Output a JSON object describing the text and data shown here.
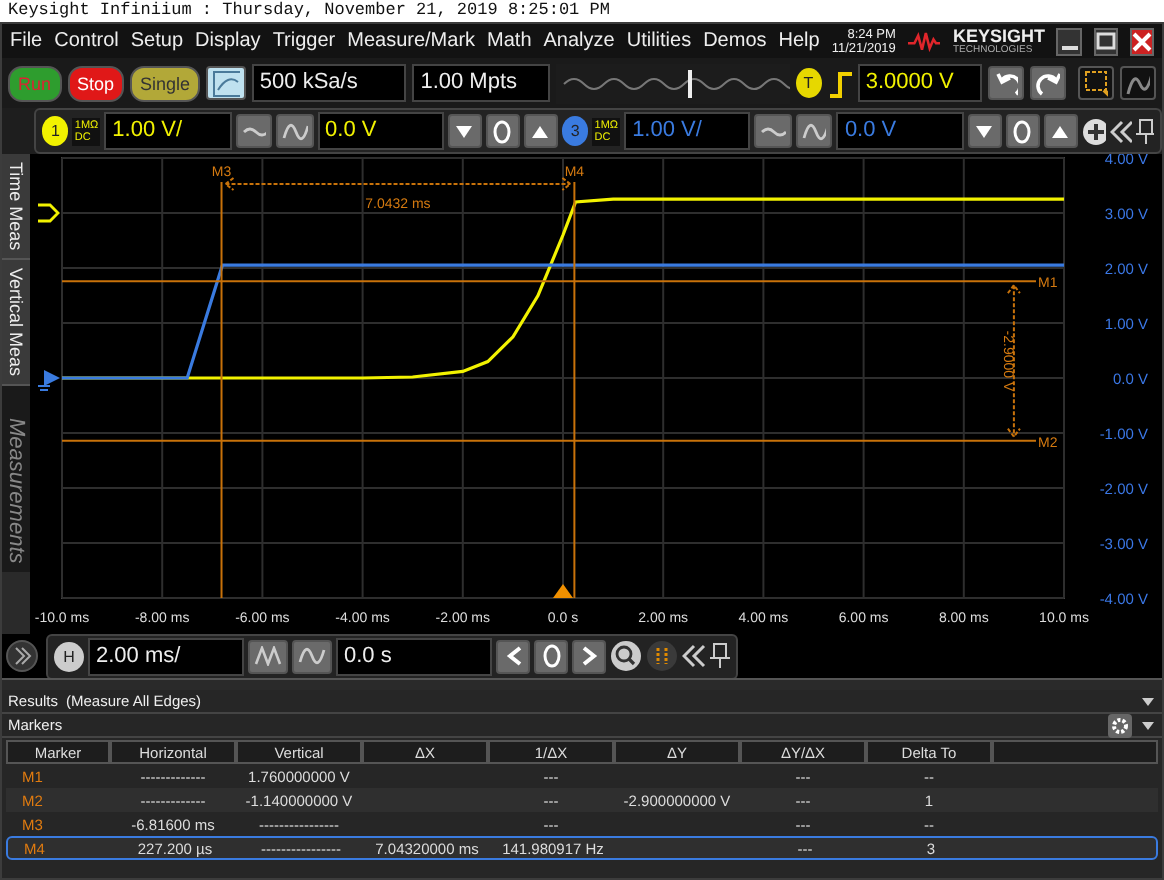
{
  "title_bar": {
    "text": "Keysight Infiniium : Thursday, November 21, 2019 8:25:01 PM"
  },
  "menu": [
    "File",
    "Control",
    "Setup",
    "Display",
    "Trigger",
    "Measure/Mark",
    "Math",
    "Analyze",
    "Utilities",
    "Demos",
    "Help"
  ],
  "clock": {
    "time": "8:24 PM",
    "date": "11/21/2019"
  },
  "brand": {
    "name": "KEYSIGHT",
    "sub": "TECHNOLOGIES"
  },
  "run_buttons": [
    {
      "label": "Run",
      "kind": "run"
    },
    {
      "label": "Stop",
      "kind": "stop"
    },
    {
      "label": "Single",
      "kind": "single"
    }
  ],
  "acquisition": {
    "sample_rate": "500 kSa/s",
    "memory": "1.00 Mpts"
  },
  "trigger": {
    "badge": "T",
    "level": "3.0000 V"
  },
  "channels": [
    {
      "impedance": "1MΩ",
      "coupling": "DC",
      "scale": "1.00 V/",
      "offset": "0.0 V"
    },
    {
      "impedance": "1MΩ",
      "coupling": "DC",
      "scale": "1.00 V/",
      "offset": "0.0 V"
    }
  ],
  "side_tabs": [
    {
      "label": "Time Meas",
      "disabled": false
    },
    {
      "label": "Vertical Meas",
      "disabled": false
    },
    {
      "label": "Measurements",
      "disabled": true
    }
  ],
  "scope": {
    "chart_data": {
      "type": "line",
      "x": [
        -10,
        -8,
        -7.5,
        -6.8,
        -6,
        -4,
        -3,
        -2,
        -1.5,
        -1,
        -0.5,
        0,
        0.25,
        1,
        2,
        4,
        6,
        8,
        10
      ],
      "series": [
        {
          "name": "1",
          "color": "#f2f200",
          "values": [
            0,
            0,
            0,
            0,
            0,
            0,
            0.02,
            0.12,
            0.3,
            0.75,
            1.5,
            2.6,
            3.2,
            3.25,
            3.25,
            3.25,
            3.25,
            3.25,
            3.25
          ]
        },
        {
          "name": "3",
          "color": "#3a7be0",
          "values": [
            0,
            0,
            0,
            2.05,
            2.05,
            2.05,
            2.05,
            2.05,
            2.05,
            2.05,
            2.05,
            2.05,
            2.05,
            2.05,
            2.05,
            2.05,
            2.05,
            2.05,
            2.05
          ]
        }
      ],
      "xlim": [
        -10,
        10
      ],
      "ylim": [
        -4,
        4
      ],
      "xticks": [
        {
          "value": -10,
          "label": "-10.0 ms"
        },
        {
          "value": -8,
          "label": "-8.00 ms"
        },
        {
          "value": -6,
          "label": "-6.00 ms"
        },
        {
          "value": -4,
          "label": "-4.00 ms"
        },
        {
          "value": -2,
          "label": "-2.00 ms"
        },
        {
          "value": 0,
          "label": "0.0 s"
        },
        {
          "value": 2,
          "label": "2.00 ms"
        },
        {
          "value": 4,
          "label": "4.00 ms"
        },
        {
          "value": 6,
          "label": "6.00 ms"
        },
        {
          "value": 8,
          "label": "8.00 ms"
        },
        {
          "value": 10,
          "label": "10.0 ms"
        }
      ],
      "yticks": [
        {
          "value": 4,
          "label": "4.00 V"
        },
        {
          "value": 3,
          "label": "3.00 V"
        },
        {
          "value": 2,
          "label": "2.00 V"
        },
        {
          "value": 1,
          "label": "1.00 V"
        },
        {
          "value": 0,
          "label": "0.0 V"
        },
        {
          "value": -1,
          "label": "-1.00 V"
        },
        {
          "value": -2,
          "label": "-2.00 V"
        },
        {
          "value": -3,
          "label": "-3.00 V"
        },
        {
          "value": -4,
          "label": "-4.00 V"
        }
      ],
      "ref_lines": [
        {
          "axis": "y",
          "value": 1.76,
          "label": "M1"
        },
        {
          "axis": "y",
          "value": -1.14,
          "label": "M2"
        },
        {
          "axis": "x",
          "value": -6.816,
          "label": "M3"
        },
        {
          "axis": "x",
          "value": 0.2272,
          "label": "M4"
        }
      ],
      "grid": true,
      "annotations": [
        "7.0432 ms",
        "-2.9000 V"
      ]
    }
  },
  "timebase": {
    "badge": "H",
    "scale": "2.00 ms/",
    "position": "0.0 s"
  },
  "results": {
    "title": "Results",
    "subtitle": "(Measure All Edges)"
  },
  "markers_panel": {
    "title": "Markers",
    "columns": [
      "Marker",
      "Horizontal",
      "Vertical",
      "ΔX",
      "1/ΔX",
      "ΔY",
      "ΔY/ΔX",
      "Delta To"
    ],
    "rows": [
      {
        "marker": "M1",
        "horizontal": "-------------",
        "vertical": "1.760000000 V",
        "inv_dx": "---",
        "dy_dx": "---",
        "delta_to": "--",
        "selected": false
      },
      {
        "marker": "M2",
        "horizontal": "-------------",
        "vertical": "-1.140000000 V",
        "inv_dx": "---",
        "dy": "-2.900000000 V",
        "dy_dx": "---",
        "delta_to": "1",
        "selected": false
      },
      {
        "marker": "M3",
        "horizontal": "-6.81600 ms",
        "vertical": "----------------",
        "inv_dx": "---",
        "dy_dx": "---",
        "delta_to": "--",
        "selected": false
      },
      {
        "marker": "M4",
        "horizontal": "227.200 µs",
        "vertical": "----------------",
        "dx": "7.04320000 ms",
        "inv_dx": "141.980917 Hz",
        "dy_dx": "---",
        "delta_to": "3",
        "selected": true
      }
    ]
  }
}
